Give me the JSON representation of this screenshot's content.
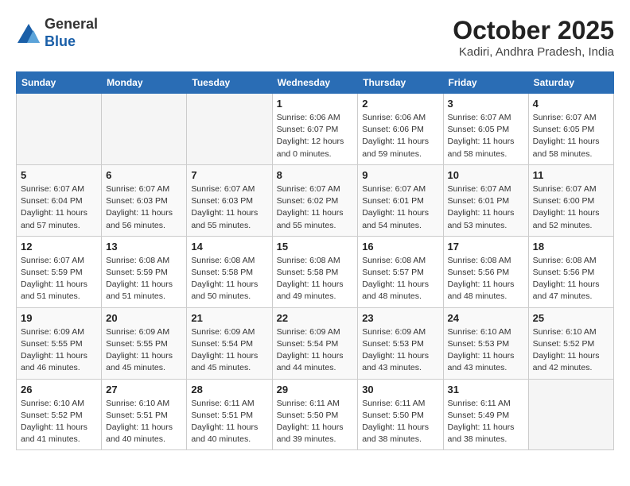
{
  "header": {
    "logo_line1": "General",
    "logo_line2": "Blue",
    "month_title": "October 2025",
    "location": "Kadiri, Andhra Pradesh, India"
  },
  "weekdays": [
    "Sunday",
    "Monday",
    "Tuesday",
    "Wednesday",
    "Thursday",
    "Friday",
    "Saturday"
  ],
  "weeks": [
    [
      {
        "day": "",
        "info": ""
      },
      {
        "day": "",
        "info": ""
      },
      {
        "day": "",
        "info": ""
      },
      {
        "day": "1",
        "info": "Sunrise: 6:06 AM\nSunset: 6:07 PM\nDaylight: 12 hours\nand 0 minutes."
      },
      {
        "day": "2",
        "info": "Sunrise: 6:06 AM\nSunset: 6:06 PM\nDaylight: 11 hours\nand 59 minutes."
      },
      {
        "day": "3",
        "info": "Sunrise: 6:07 AM\nSunset: 6:05 PM\nDaylight: 11 hours\nand 58 minutes."
      },
      {
        "day": "4",
        "info": "Sunrise: 6:07 AM\nSunset: 6:05 PM\nDaylight: 11 hours\nand 58 minutes."
      }
    ],
    [
      {
        "day": "5",
        "info": "Sunrise: 6:07 AM\nSunset: 6:04 PM\nDaylight: 11 hours\nand 57 minutes."
      },
      {
        "day": "6",
        "info": "Sunrise: 6:07 AM\nSunset: 6:03 PM\nDaylight: 11 hours\nand 56 minutes."
      },
      {
        "day": "7",
        "info": "Sunrise: 6:07 AM\nSunset: 6:03 PM\nDaylight: 11 hours\nand 55 minutes."
      },
      {
        "day": "8",
        "info": "Sunrise: 6:07 AM\nSunset: 6:02 PM\nDaylight: 11 hours\nand 55 minutes."
      },
      {
        "day": "9",
        "info": "Sunrise: 6:07 AM\nSunset: 6:01 PM\nDaylight: 11 hours\nand 54 minutes."
      },
      {
        "day": "10",
        "info": "Sunrise: 6:07 AM\nSunset: 6:01 PM\nDaylight: 11 hours\nand 53 minutes."
      },
      {
        "day": "11",
        "info": "Sunrise: 6:07 AM\nSunset: 6:00 PM\nDaylight: 11 hours\nand 52 minutes."
      }
    ],
    [
      {
        "day": "12",
        "info": "Sunrise: 6:07 AM\nSunset: 5:59 PM\nDaylight: 11 hours\nand 51 minutes."
      },
      {
        "day": "13",
        "info": "Sunrise: 6:08 AM\nSunset: 5:59 PM\nDaylight: 11 hours\nand 51 minutes."
      },
      {
        "day": "14",
        "info": "Sunrise: 6:08 AM\nSunset: 5:58 PM\nDaylight: 11 hours\nand 50 minutes."
      },
      {
        "day": "15",
        "info": "Sunrise: 6:08 AM\nSunset: 5:58 PM\nDaylight: 11 hours\nand 49 minutes."
      },
      {
        "day": "16",
        "info": "Sunrise: 6:08 AM\nSunset: 5:57 PM\nDaylight: 11 hours\nand 48 minutes."
      },
      {
        "day": "17",
        "info": "Sunrise: 6:08 AM\nSunset: 5:56 PM\nDaylight: 11 hours\nand 48 minutes."
      },
      {
        "day": "18",
        "info": "Sunrise: 6:08 AM\nSunset: 5:56 PM\nDaylight: 11 hours\nand 47 minutes."
      }
    ],
    [
      {
        "day": "19",
        "info": "Sunrise: 6:09 AM\nSunset: 5:55 PM\nDaylight: 11 hours\nand 46 minutes."
      },
      {
        "day": "20",
        "info": "Sunrise: 6:09 AM\nSunset: 5:55 PM\nDaylight: 11 hours\nand 45 minutes."
      },
      {
        "day": "21",
        "info": "Sunrise: 6:09 AM\nSunset: 5:54 PM\nDaylight: 11 hours\nand 45 minutes."
      },
      {
        "day": "22",
        "info": "Sunrise: 6:09 AM\nSunset: 5:54 PM\nDaylight: 11 hours\nand 44 minutes."
      },
      {
        "day": "23",
        "info": "Sunrise: 6:09 AM\nSunset: 5:53 PM\nDaylight: 11 hours\nand 43 minutes."
      },
      {
        "day": "24",
        "info": "Sunrise: 6:10 AM\nSunset: 5:53 PM\nDaylight: 11 hours\nand 43 minutes."
      },
      {
        "day": "25",
        "info": "Sunrise: 6:10 AM\nSunset: 5:52 PM\nDaylight: 11 hours\nand 42 minutes."
      }
    ],
    [
      {
        "day": "26",
        "info": "Sunrise: 6:10 AM\nSunset: 5:52 PM\nDaylight: 11 hours\nand 41 minutes."
      },
      {
        "day": "27",
        "info": "Sunrise: 6:10 AM\nSunset: 5:51 PM\nDaylight: 11 hours\nand 40 minutes."
      },
      {
        "day": "28",
        "info": "Sunrise: 6:11 AM\nSunset: 5:51 PM\nDaylight: 11 hours\nand 40 minutes."
      },
      {
        "day": "29",
        "info": "Sunrise: 6:11 AM\nSunset: 5:50 PM\nDaylight: 11 hours\nand 39 minutes."
      },
      {
        "day": "30",
        "info": "Sunrise: 6:11 AM\nSunset: 5:50 PM\nDaylight: 11 hours\nand 38 minutes."
      },
      {
        "day": "31",
        "info": "Sunrise: 6:11 AM\nSunset: 5:49 PM\nDaylight: 11 hours\nand 38 minutes."
      },
      {
        "day": "",
        "info": ""
      }
    ]
  ]
}
